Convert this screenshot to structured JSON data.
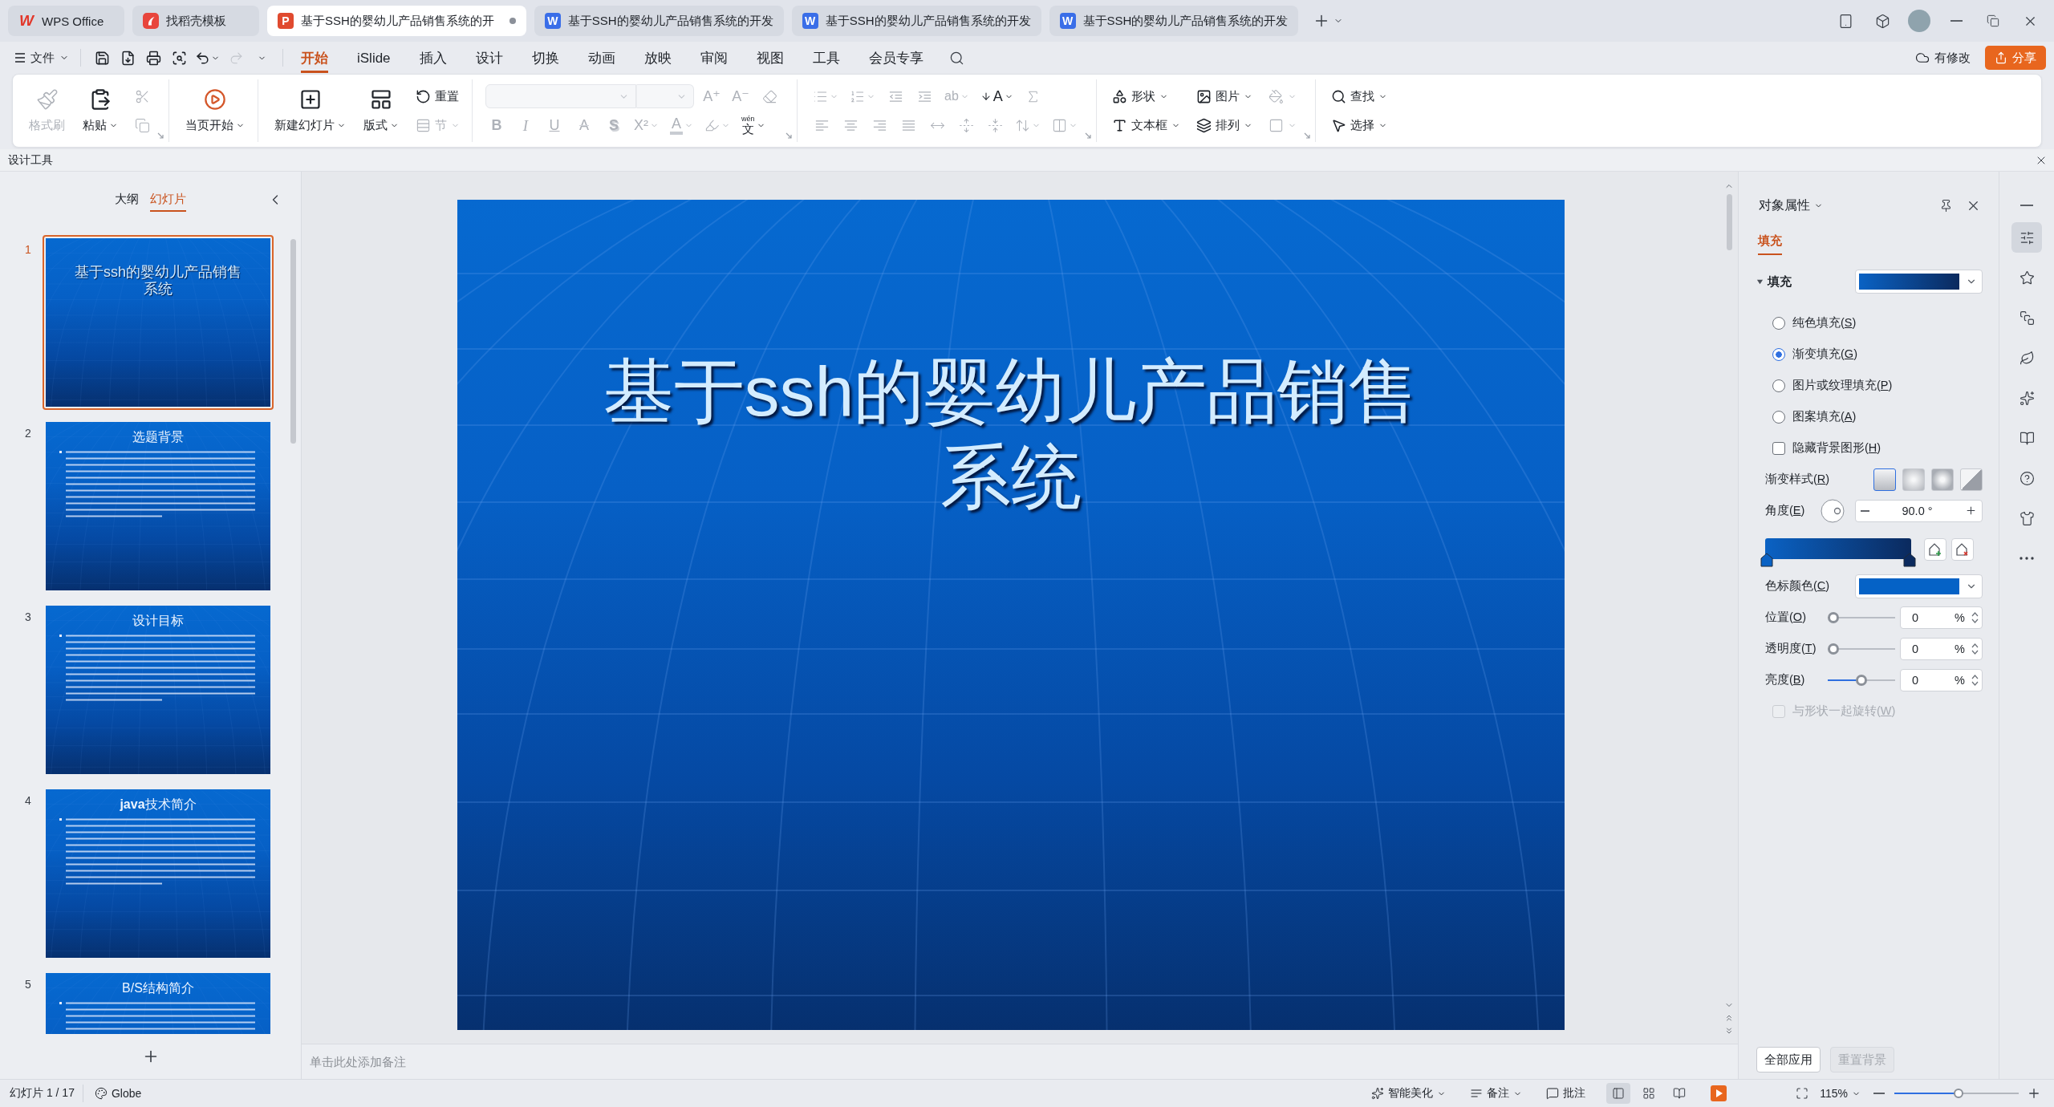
{
  "tabs": [
    {
      "kind": "home",
      "logo": "W",
      "label": "WPS Office",
      "selected": false,
      "unsaved": false
    },
    {
      "kind": "docer",
      "label": "找稻壳模板",
      "selected": false,
      "unsaved": false
    },
    {
      "kind": "presentation",
      "logo": "P",
      "label": "基于SSH的婴幼儿产品销售系统的开",
      "selected": true,
      "unsaved": true
    },
    {
      "kind": "writer",
      "logo": "W",
      "label": "基于SSH的婴幼儿产品销售系统的开发",
      "selected": false,
      "unsaved": false
    },
    {
      "kind": "writer",
      "logo": "W",
      "label": "基于SSH的婴幼儿产品销售系统的开发",
      "selected": false,
      "unsaved": false
    },
    {
      "kind": "writer",
      "logo": "W",
      "label": "基于SSH的婴幼儿产品销售系统的开发",
      "selected": false,
      "unsaved": false
    }
  ],
  "menu": {
    "file": "文件",
    "quick_access": [
      {
        "kind": "save",
        "caret": false,
        "disabled": false
      },
      {
        "kind": "export-pdf",
        "caret": false,
        "disabled": false
      },
      {
        "kind": "print",
        "caret": false,
        "disabled": false
      },
      {
        "kind": "print-preview",
        "caret": false,
        "disabled": false
      },
      {
        "kind": "undo",
        "caret": true,
        "disabled": false
      },
      {
        "kind": "redo",
        "caret": false,
        "disabled": true
      },
      {
        "kind": "more",
        "caret": true,
        "disabled": false
      }
    ],
    "tabs": [
      {
        "label": "开始",
        "selected": true
      },
      {
        "label": "iSlide",
        "selected": false
      },
      {
        "label": "插入",
        "selected": false
      },
      {
        "label": "设计",
        "selected": false
      },
      {
        "label": "切换",
        "selected": false
      },
      {
        "label": "动画",
        "selected": false
      },
      {
        "label": "放映",
        "selected": false
      },
      {
        "label": "审阅",
        "selected": false
      },
      {
        "label": "视图",
        "selected": false
      },
      {
        "label": "工具",
        "selected": false
      },
      {
        "label": "会员专享",
        "selected": false
      }
    ],
    "save_status": "有修改",
    "share": "分享"
  },
  "ribbon": {
    "groups": [
      {
        "launcher": true,
        "items": [
          {
            "kind": "format-painter",
            "label": "格式刷",
            "caret": false,
            "disabled": true
          },
          {
            "kind": "paste",
            "label": "粘贴",
            "caret": true,
            "disabled": false
          },
          {
            "items": [
              {
                "kind": "cut",
                "caret": false,
                "disabled": true
              },
              {
                "kind": "copy",
                "caret": false,
                "disabled": true
              }
            ]
          }
        ]
      },
      {
        "launcher": false,
        "items": [
          {
            "kind": "play-current",
            "label": "当页开始",
            "caret": true,
            "disabled": false
          }
        ]
      },
      {
        "launcher": false,
        "items": [
          {
            "kind": "new-slide",
            "label": "新建幻灯片",
            "caret": true,
            "disabled": false
          },
          {
            "kind": "layout",
            "label": "版式",
            "caret": true,
            "disabled": false
          },
          {
            "items": [
              {
                "kind": "reset",
                "label": "重置",
                "caret": false,
                "disabled": false
              },
              {
                "kind": "section",
                "label": "节",
                "caret": true,
                "disabled": true
              }
            ]
          }
        ]
      },
      {
        "launcher": true,
        "upper": [
          {
            "kind": "font-name",
            "disabled": true
          },
          {
            "kind": "font-size",
            "disabled": true
          },
          {
            "kind": "grow-font",
            "glyph": "A⁺",
            "caret": false,
            "disabled": true
          },
          {
            "kind": "shrink-font",
            "glyph": "A⁻",
            "caret": false,
            "disabled": true
          },
          {
            "kind": "clear-format",
            "caret": false,
            "disabled": true
          }
        ],
        "lower": [
          {
            "kind": "bold",
            "glyph": "B",
            "caret": false,
            "disabled": true
          },
          {
            "kind": "italic",
            "glyph": "I",
            "caret": false,
            "disabled": true
          },
          {
            "kind": "underline",
            "glyph": "U",
            "caret": false,
            "disabled": true
          },
          {
            "kind": "strikethrough",
            "glyph": "A",
            "caret": false,
            "disabled": true
          },
          {
            "kind": "shadow",
            "glyph": "S",
            "caret": false,
            "disabled": true
          },
          {
            "kind": "superscript",
            "glyph": "X²",
            "caret": true,
            "disabled": true
          },
          {
            "kind": "font-color",
            "glyph": "A",
            "caret": true,
            "disabled": true
          },
          {
            "kind": "highlight",
            "caret": true,
            "disabled": true
          },
          {
            "kind": "phonetic",
            "glyph": "文",
            "ruby": "wén",
            "caret": true,
            "disabled": false
          }
        ]
      },
      {
        "launcher": true,
        "upper": [
          {
            "kind": "bullets",
            "caret": true,
            "disabled": true
          },
          {
            "kind": "numbering",
            "caret": true,
            "disabled": true
          },
          {
            "kind": "outdent",
            "caret": false,
            "disabled": true
          },
          {
            "kind": "indent",
            "caret": false,
            "disabled": true
          },
          {
            "kind": "text-effect",
            "glyph": "ab",
            "caret": true,
            "disabled": true
          },
          {
            "kind": "text-direction",
            "glyph": "A",
            "caret": true,
            "disabled": false
          },
          {
            "kind": "convert",
            "caret": false,
            "disabled": true
          }
        ],
        "lower": [
          {
            "kind": "align-left",
            "caret": false,
            "disabled": true
          },
          {
            "kind": "align-center",
            "caret": false,
            "disabled": true
          },
          {
            "kind": "align-right",
            "caret": false,
            "disabled": true
          },
          {
            "kind": "justify",
            "caret": false,
            "disabled": true
          },
          {
            "kind": "distributed",
            "caret": false,
            "disabled": true
          },
          {
            "kind": "space-before",
            "caret": false,
            "disabled": true
          },
          {
            "kind": "space-after",
            "caret": false,
            "disabled": true
          },
          {
            "kind": "line-spacing",
            "caret": true,
            "disabled": true
          },
          {
            "kind": "vertical-align",
            "caret": true,
            "disabled": true
          }
        ]
      },
      {
        "launcher": true,
        "items": [
          {
            "items": [
              {
                "kind": "shape",
                "label": "形状",
                "caret": true,
                "disabled": false
              },
              {
                "kind": "textbox",
                "label": "文本框",
                "caret": true,
                "disabled": false
              }
            ]
          },
          {
            "items": [
              {
                "kind": "picture",
                "label": "图片",
                "caret": true,
                "disabled": false
              },
              {
                "kind": "arrange",
                "label": "排列",
                "caret": true,
                "disabled": false
              }
            ]
          },
          {
            "items": [
              {
                "kind": "fill",
                "caret": true,
                "disabled": true
              },
              {
                "kind": "outline",
                "caret": true,
                "disabled": true
              }
            ]
          }
        ]
      },
      {
        "launcher": false,
        "items": [
          {
            "items": [
              {
                "kind": "find",
                "label": "查找",
                "caret": true,
                "disabled": false
              },
              {
                "kind": "select",
                "label": "选择",
                "caret": true,
                "disabled": false
              }
            ]
          }
        ]
      }
    ]
  },
  "design_tools": "设计工具",
  "slide_panel": {
    "view_tabs": [
      {
        "label": "大纲",
        "selected": false
      },
      {
        "label": "幻灯片",
        "selected": true
      }
    ],
    "slides": [
      {
        "number": "1",
        "kind": "title",
        "title": "基于ssh的婴幼儿产品销售系统",
        "selected": true
      },
      {
        "number": "2",
        "kind": "content",
        "title": "选题背景",
        "selected": false
      },
      {
        "number": "3",
        "kind": "content",
        "title": "设计目标",
        "selected": false
      },
      {
        "number": "4",
        "kind": "content",
        "title": "**java**技术简介",
        "selected": false
      },
      {
        "number": "5",
        "kind": "content",
        "title": "B/S结构简介",
        "selected": false
      }
    ]
  },
  "slide": {
    "title": "基于ssh的婴幼儿产品销售系统"
  },
  "notes": {
    "placeholder": "单击此处添加备注"
  },
  "properties_panel": {
    "title": "对象属性",
    "tabs": [
      {
        "label": "填充",
        "selected": true
      }
    ],
    "fill_section": {
      "label": "填充",
      "expanded": true
    },
    "fill_options": [
      {
        "label": "纯色填充(S)",
        "selected": false
      },
      {
        "label": "渐变填充(G)",
        "selected": true
      },
      {
        "label": "图片或纹理填充(P)",
        "selected": false
      },
      {
        "label": "图案填充(A)",
        "selected": false
      }
    ],
    "hide_background": {
      "label": "隐藏背景图形(H)",
      "checked": false
    },
    "gradient_style": {
      "label": "渐变样式(R)",
      "styles": [
        {
          "kind": "linear",
          "selected": true
        },
        {
          "kind": "radial",
          "selected": false
        },
        {
          "kind": "rectangular",
          "selected": false
        },
        {
          "kind": "path",
          "selected": false
        }
      ]
    },
    "angle": {
      "label": "角度(E)",
      "value": "90.0 °"
    },
    "gradient_stops": [
      {
        "color": "#0a62c4"
      },
      {
        "color": "#0b2a5e"
      }
    ],
    "stop_color": {
      "label": "色标颜色(C)",
      "color": "#0562c6"
    },
    "sliders": [
      {
        "label": "位置(O)",
        "level": 0,
        "value": "0",
        "unit": "%"
      },
      {
        "label": "透明度(T)",
        "level": 0,
        "value": "0",
        "unit": "%"
      },
      {
        "label": "亮度(B)",
        "level": 0.5,
        "value": "0",
        "unit": "%"
      }
    ],
    "rotate_with_shape": {
      "label": "与形状一起旋转(W)",
      "checked": false,
      "disabled": true
    },
    "buttons": [
      {
        "label": "全部应用",
        "disabled": false
      },
      {
        "label": "重置背景",
        "disabled": true
      }
    ]
  },
  "side_rail": [
    {
      "kind": "collapse",
      "selected": false
    },
    {
      "kind": "properties",
      "selected": true
    },
    {
      "kind": "favorites",
      "selected": false
    },
    {
      "kind": "transition",
      "selected": false
    },
    {
      "kind": "beautify",
      "selected": false
    },
    {
      "kind": "magic",
      "selected": false
    },
    {
      "kind": "find-template",
      "selected": false
    },
    {
      "kind": "help",
      "selected": false
    },
    {
      "kind": "theme",
      "selected": false
    },
    {
      "kind": "more",
      "selected": false
    }
  ],
  "status_bar": {
    "slide_counter": "幻灯片 1 / 17",
    "theme": "Globe",
    "beautify": "智能美化",
    "notes": "备注",
    "comments": "批注",
    "views": [
      {
        "kind": "normal",
        "selected": true
      },
      {
        "kind": "sorter",
        "selected": false
      },
      {
        "kind": "reading",
        "selected": false
      }
    ],
    "zoom": "115%",
    "zoom_slider": {
      "level": 0.52
    }
  }
}
